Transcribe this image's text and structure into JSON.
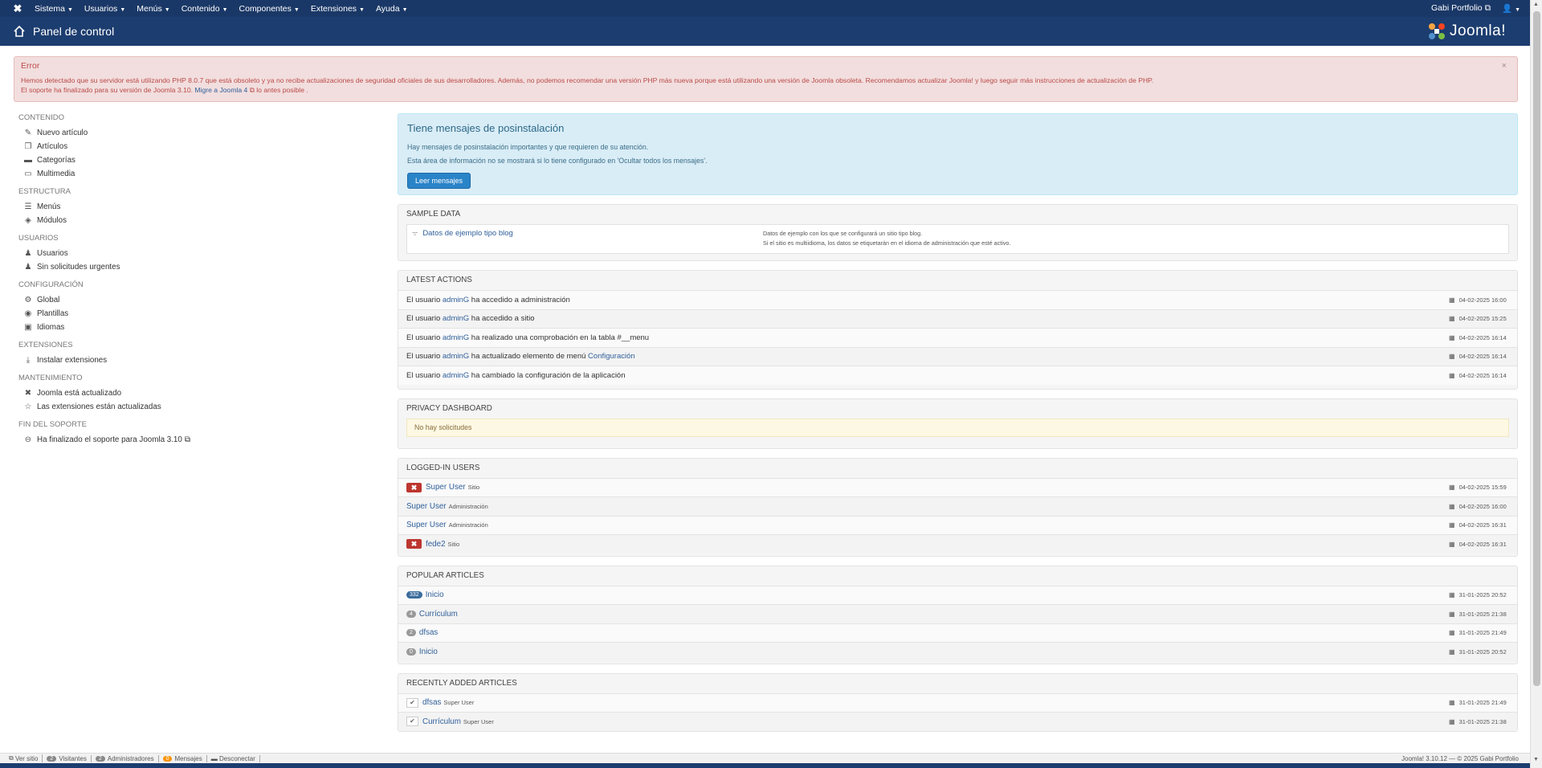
{
  "topnav": {
    "menu": [
      "Sistema",
      "Usuarios",
      "Menús",
      "Contenido",
      "Componentes",
      "Extensiones",
      "Ayuda"
    ],
    "site_link": "Gabi Portfolio"
  },
  "header": {
    "title": "Panel de control",
    "brand": "Joomla!"
  },
  "alert": {
    "title": "Error",
    "line1": "Hemos detectado que su servidor está utilizando PHP 8.0.7 que está obsoleto y ya no recibe actualizaciones de seguridad oficiales de sus desarrolladores. Además, no podemos recomendar una versión PHP más nueva porque está utilizando una versión de Joomla obsoleta. Recomendamos actualizar Joomla! y luego seguir más instrucciones de actualización de PHP.",
    "line2_pre": "El soporte ha finalizado para su versión de Joomla 3.10.",
    "line2_link": "Migre a Joomla 4",
    "line2_post": "lo antes posible ."
  },
  "sidebar": {
    "sections": [
      {
        "head": "CONTENIDO",
        "items": [
          {
            "label": "Nuevo artículo",
            "icon": "pencil-icon"
          },
          {
            "label": "Artículos",
            "icon": "copy-icon"
          },
          {
            "label": "Categorías",
            "icon": "folder-icon"
          },
          {
            "label": "Multimedia",
            "icon": "image-icon"
          }
        ]
      },
      {
        "head": "ESTRUCTURA",
        "items": [
          {
            "label": "Menús",
            "icon": "list-icon"
          },
          {
            "label": "Módulos",
            "icon": "cube-icon"
          }
        ]
      },
      {
        "head": "USUARIOS",
        "items": [
          {
            "label": "Usuarios",
            "icon": "users-icon"
          },
          {
            "label": "Sin solicitudes urgentes",
            "icon": "users-icon"
          }
        ]
      },
      {
        "head": "CONFIGURACIÓN",
        "items": [
          {
            "label": "Global",
            "icon": "gear-icon"
          },
          {
            "label": "Plantillas",
            "icon": "eye-icon"
          },
          {
            "label": "Idiomas",
            "icon": "comments-icon"
          }
        ]
      },
      {
        "head": "EXTENSIONES",
        "items": [
          {
            "label": "Instalar extensiones",
            "icon": "download-icon"
          }
        ]
      },
      {
        "head": "MANTENIMIENTO",
        "items": [
          {
            "label": "Joomla está actualizado",
            "icon": "joomla-icon"
          },
          {
            "label": "Las extensiones están actualizadas",
            "icon": "star-icon"
          }
        ]
      },
      {
        "head": "FIN DEL SOPORTE",
        "items": [
          {
            "label": "Ha finalizado el soporte para Joomla 3.10",
            "icon": "minus-circle-icon"
          }
        ]
      }
    ]
  },
  "posinstall": {
    "title": "Tiene mensajes de posinstalación",
    "line1": "Hay mensajes de posinstalación importantes y que requieren de su atención.",
    "line2": "Esta área de información no se mostrará si lo tiene configurado en 'Ocultar todos los mensajes'.",
    "button": "Leer mensajes"
  },
  "sample_data": {
    "head": "SAMPLE DATA",
    "item": "Datos de ejemplo tipo blog",
    "desc1": "Datos de ejemplo con los que se configurará un sitio tipo blog.",
    "desc2": "Si el sitio es multiidioma, los datos se etiquetarán en el idioma de administración que esté activo."
  },
  "latest_actions": {
    "head": "LATEST ACTIONS",
    "rows": [
      {
        "pre": "El usuario",
        "user": "adminG",
        "text": "ha accedido a administración",
        "link": "",
        "date": "04-02-2025 16:00"
      },
      {
        "pre": "El usuario",
        "user": "adminG",
        "text": "ha accedido a sitio",
        "link": "",
        "date": "04-02-2025 15:25"
      },
      {
        "pre": "El usuario",
        "user": "adminG",
        "text": "ha realizado una comprobación en la tabla #__menu",
        "link": "",
        "date": "04-02-2025 16:14"
      },
      {
        "pre": "El usuario",
        "user": "adminG",
        "text": "ha actualizado elemento de menú",
        "link": "Configuración",
        "date": "04-02-2025 16:14"
      },
      {
        "pre": "El usuario",
        "user": "adminG",
        "text": "ha cambiado la configuración de la aplicación",
        "link": "",
        "date": "04-02-2025 16:14"
      }
    ]
  },
  "privacy": {
    "head": "PRIVACY DASHBOARD",
    "message": "No hay solicitudes"
  },
  "logged_in": {
    "head": "LOGGED-IN USERS",
    "rows": [
      {
        "name": "Super User",
        "where": "Sitio",
        "logout": true,
        "date": "04-02-2025 15:59"
      },
      {
        "name": "Super User",
        "where": "Administración",
        "logout": false,
        "date": "04-02-2025 16:00"
      },
      {
        "name": "Super User",
        "where": "Administración",
        "logout": false,
        "date": "04-02-2025 16:31"
      },
      {
        "name": "fede2",
        "where": "Sitio",
        "logout": true,
        "date": "04-02-2025 16:31"
      }
    ]
  },
  "popular": {
    "head": "POPULAR ARTICLES",
    "rows": [
      {
        "hits": "332",
        "title": "Inicio",
        "date": "31-01-2025 20:52"
      },
      {
        "hits": "4",
        "title": "Currículum",
        "date": "31-01-2025 21:38"
      },
      {
        "hits": "2",
        "title": "dfsas",
        "date": "31-01-2025 21:49"
      },
      {
        "hits": "0",
        "title": "Inicio",
        "date": "31-01-2025 20:52"
      }
    ]
  },
  "recent": {
    "head": "RECENTLY ADDED ARTICLES",
    "rows": [
      {
        "title": "dfsas",
        "author": "Super User",
        "date": "31-01-2025 21:49"
      },
      {
        "title": "Currículum",
        "author": "Super User",
        "date": "31-01-2025 21:38"
      }
    ]
  },
  "footer": {
    "ver_sitio": "Ver sitio",
    "visitantes_count": "2",
    "visitantes": "Visitantes",
    "admins_count": "2",
    "admins": "Administradores",
    "mensajes_count": "0",
    "mensajes": "Mensajes",
    "desconectar": "Desconectar",
    "copyright": "Joomla! 3.10.12 — © 2025 Gabi Portfolio"
  },
  "colors": {
    "navbar": "#1a3867",
    "header": "#1c3d6f",
    "alert_bg": "#f2dede",
    "alert_text": "#b94a48",
    "info_bg": "#d9edf7",
    "button": "#2a84c8",
    "danger": "#bd362f"
  }
}
